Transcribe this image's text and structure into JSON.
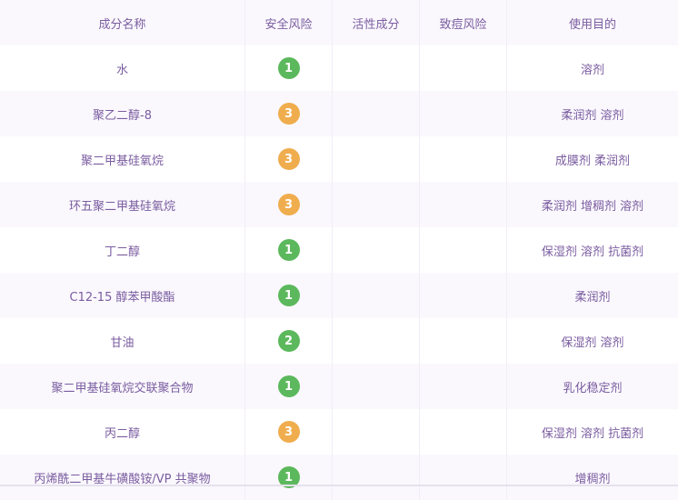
{
  "table": {
    "headers": [
      "成分名称",
      "安全风险",
      "活性成分",
      "致痘风险",
      "使用目的"
    ],
    "rows": [
      {
        "name": "水",
        "risk": "1",
        "risk_color": "#5cb85c",
        "active": "",
        "acne": "",
        "purpose": "溶剂"
      },
      {
        "name": "聚乙二醇-8",
        "risk": "3",
        "risk_color": "#f0ad4e",
        "active": "",
        "acne": "",
        "purpose": "柔润剂 溶剂"
      },
      {
        "name": "聚二甲基硅氧烷",
        "risk": "3",
        "risk_color": "#f0ad4e",
        "active": "",
        "acne": "",
        "purpose": "成膜剂 柔润剂"
      },
      {
        "name": "环五聚二甲基硅氧烷",
        "risk": "3",
        "risk_color": "#f0ad4e",
        "active": "",
        "acne": "",
        "purpose": "柔润剂 增稠剂 溶剂"
      },
      {
        "name": "丁二醇",
        "risk": "1",
        "risk_color": "#5cb85c",
        "active": "",
        "acne": "",
        "purpose": "保湿剂 溶剂 抗菌剂"
      },
      {
        "name": "C12-15 醇苯甲酸酯",
        "risk": "1",
        "risk_color": "#5cb85c",
        "active": "",
        "acne": "",
        "purpose": "柔润剂"
      },
      {
        "name": "甘油",
        "risk": "2",
        "risk_color": "#5cb85c",
        "active": "",
        "acne": "",
        "purpose": "保湿剂 溶剂"
      },
      {
        "name": "聚二甲基硅氧烷交联聚合物",
        "risk": "1",
        "risk_color": "#5cb85c",
        "active": "",
        "acne": "",
        "purpose": "乳化稳定剂"
      },
      {
        "name": "丙二醇",
        "risk": "3",
        "risk_color": "#f0ad4e",
        "active": "",
        "acne": "",
        "purpose": "保湿剂 溶剂 抗菌剂"
      },
      {
        "name": "丙烯酰二甲基牛磺酸铵/VP 共聚物",
        "risk": "1",
        "risk_color": "#5cb85c",
        "active": "",
        "acne": "",
        "purpose": "增稠剂"
      }
    ]
  }
}
